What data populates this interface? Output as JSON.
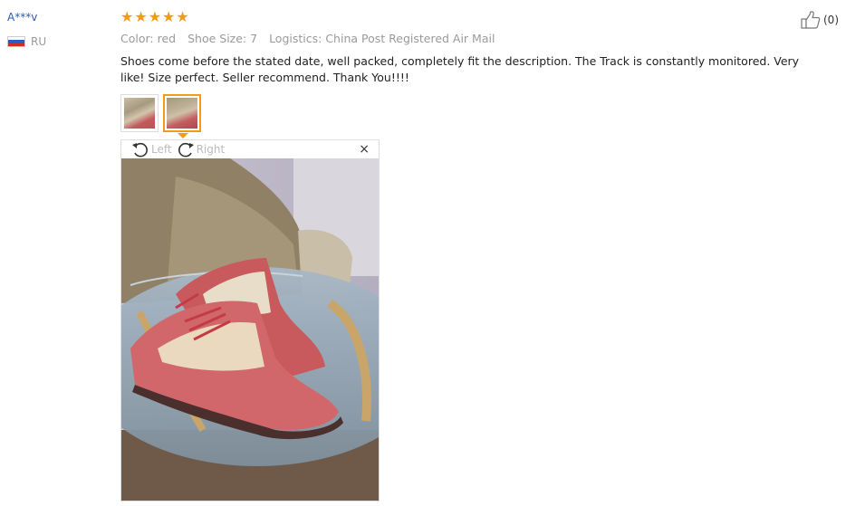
{
  "reviewer": {
    "name": "A***v",
    "country": "RU",
    "flag_colors": [
      "#ffffff",
      "#2d5bc4",
      "#d52b1e"
    ]
  },
  "rating": {
    "stars": 5,
    "color": "#f39b17"
  },
  "helpful": {
    "count": "(0)",
    "icon": "thumbs-up-icon"
  },
  "meta": {
    "color": "Color: red",
    "size": "Shoe Size: 7",
    "logistics": "Logistics: China Post Registered Air Mail"
  },
  "review_text": "Shoes come before the stated date, well packed, completely fit the description. The Track is constantly monitored. Very like! Size perfect. Seller recommend. Thank You!!!!",
  "viewer": {
    "rotate_left": "Left",
    "rotate_right": "Right",
    "close": "×"
  }
}
